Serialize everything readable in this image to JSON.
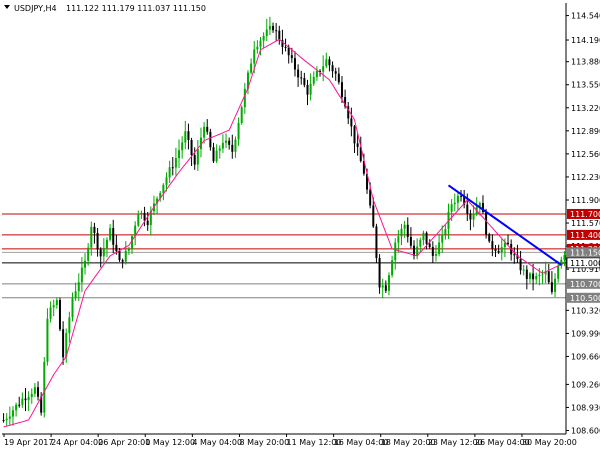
{
  "header": {
    "symbol": "USDJPY,H4",
    "ohlc": "111.122 111.179 111.037 111.150",
    "menu_icon": "triangle-down-icon"
  },
  "colors": {
    "bull": "#00aa00",
    "bear": "#000000",
    "ma": "#ff1493",
    "trendline": "#0000ff",
    "red_level": "#c00000",
    "gray_level": "#808080",
    "black_level": "#000000",
    "bid_label": "#808080"
  },
  "chart_data": {
    "type": "candlestick",
    "title": "USDJPY,H4",
    "ylim": [
      108.55,
      114.72
    ],
    "y_ticks": [
      114.54,
      114.19,
      113.88,
      113.55,
      113.22,
      112.89,
      112.56,
      112.23,
      111.9,
      111.57,
      111.24,
      110.91,
      110.32,
      109.99,
      109.66,
      109.26,
      108.93,
      108.6
    ],
    "y_tick_labels": [
      "114.540",
      "114.190",
      "113.880",
      "113.550",
      "113.220",
      "112.890",
      "112.560",
      "112.230",
      "111.900",
      "111.570",
      "111.240",
      "110.910",
      "110.320",
      "109.990",
      "109.660",
      "109.260",
      "108.930",
      "108.600"
    ],
    "x_tick_labels": [
      "19 Apr 2017",
      "24 Apr 04:00",
      "26 Apr 20:00",
      "1 May 12:00",
      "4 May 04:00",
      "8 May 20:00",
      "11 May 12:00",
      "16 May 04:00",
      "18 May 20:00",
      "23 May 12:00",
      "26 May 04:00",
      "30 May 20:00"
    ],
    "bid": {
      "value": 111.15,
      "label": "111.150"
    },
    "levels": [
      {
        "value": 111.7,
        "label": "111.700",
        "color": "red"
      },
      {
        "value": 111.4,
        "label": "111.400",
        "color": "red"
      },
      {
        "value": 111.2,
        "label": "111.200",
        "color": "red"
      },
      {
        "value": 111.0,
        "label": "111.000",
        "color": "black"
      },
      {
        "value": 110.7,
        "label": "110.700",
        "color": "gray"
      },
      {
        "value": 110.5,
        "label": "110.500",
        "color": "gray"
      }
    ],
    "trendline": {
      "start": {
        "bar": 142,
        "price": 112.11
      },
      "end": {
        "bar": 178,
        "price": 110.97
      }
    },
    "ma_anchors": [
      [
        0,
        108.65
      ],
      [
        8,
        108.75
      ],
      [
        16,
        109.4
      ],
      [
        20,
        109.66
      ],
      [
        26,
        110.6
      ],
      [
        34,
        111.1
      ],
      [
        40,
        111.25
      ],
      [
        48,
        111.8
      ],
      [
        56,
        112.3
      ],
      [
        64,
        112.75
      ],
      [
        72,
        112.9
      ],
      [
        78,
        113.5
      ],
      [
        82,
        114.05
      ],
      [
        88,
        114.2
      ],
      [
        96,
        113.9
      ],
      [
        104,
        113.62
      ],
      [
        112,
        113.05
      ],
      [
        118,
        111.9
      ],
      [
        124,
        111.2
      ],
      [
        132,
        111.1
      ],
      [
        140,
        111.5
      ],
      [
        148,
        111.9
      ],
      [
        156,
        111.5
      ],
      [
        164,
        111.1
      ],
      [
        172,
        110.85
      ],
      [
        179,
        111.0
      ]
    ],
    "price_anchors": [
      [
        0,
        108.75
      ],
      [
        6,
        109.05
      ],
      [
        10,
        109.2
      ],
      [
        12,
        108.85
      ],
      [
        14,
        110.25
      ],
      [
        17,
        110.45
      ],
      [
        19,
        109.66
      ],
      [
        22,
        110.5
      ],
      [
        26,
        111.0
      ],
      [
        28,
        111.55
      ],
      [
        31,
        111.1
      ],
      [
        34,
        111.45
      ],
      [
        37,
        111.0
      ],
      [
        40,
        111.2
      ],
      [
        43,
        111.75
      ],
      [
        46,
        111.6
      ],
      [
        50,
        112.05
      ],
      [
        55,
        112.5
      ],
      [
        58,
        112.85
      ],
      [
        61,
        112.4
      ],
      [
        64,
        113.0
      ],
      [
        67,
        112.45
      ],
      [
        70,
        112.75
      ],
      [
        73,
        112.6
      ],
      [
        76,
        113.25
      ],
      [
        80,
        114.1
      ],
      [
        83,
        114.25
      ],
      [
        86,
        114.38
      ],
      [
        90,
        114.05
      ],
      [
        94,
        113.7
      ],
      [
        97,
        113.45
      ],
      [
        100,
        113.7
      ],
      [
        103,
        113.9
      ],
      [
        106,
        113.7
      ],
      [
        109,
        113.3
      ],
      [
        112,
        112.75
      ],
      [
        115,
        112.3
      ],
      [
        118,
        111.5
      ],
      [
        120,
        110.7
      ],
      [
        122,
        110.65
      ],
      [
        125,
        111.3
      ],
      [
        128,
        111.55
      ],
      [
        131,
        111.1
      ],
      [
        134,
        111.4
      ],
      [
        137,
        111.1
      ],
      [
        140,
        111.35
      ],
      [
        143,
        111.85
      ],
      [
        146,
        112.0
      ],
      [
        149,
        111.65
      ],
      [
        152,
        111.9
      ],
      [
        155,
        111.25
      ],
      [
        158,
        111.2
      ],
      [
        161,
        111.25
      ],
      [
        164,
        111.0
      ],
      [
        167,
        110.8
      ],
      [
        170,
        110.78
      ],
      [
        173,
        110.85
      ],
      [
        175,
        110.55
      ],
      [
        177,
        111.0
      ],
      [
        179,
        111.15
      ]
    ]
  }
}
